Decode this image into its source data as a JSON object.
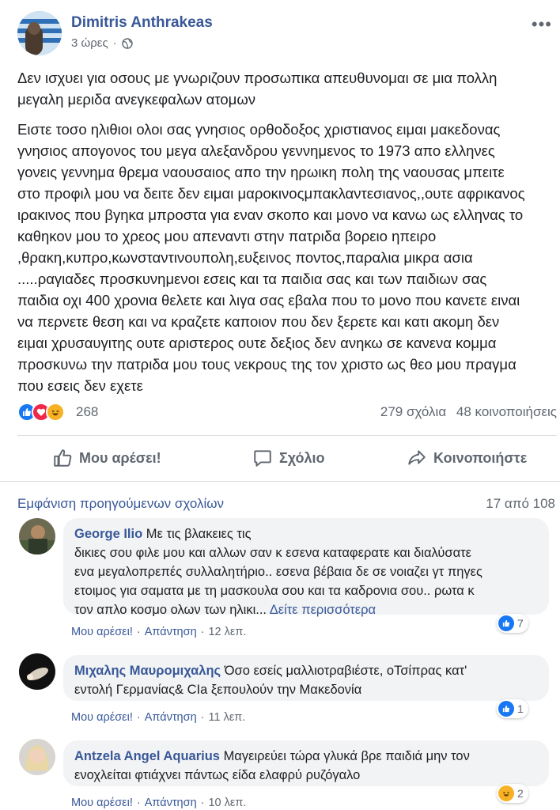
{
  "post": {
    "author": "Dimitris Anthrakeas",
    "time": "3 ώρες",
    "meta_separator": "·",
    "privacy_icon": "globe-icon",
    "more_icon": "ellipsis-icon",
    "paragraph1_lines": [
      "Δεν ισχυει για οσους με γνωριζουν προσωπικα απευθυνομαι σε μια πολλη",
      "μεγαλη μεριδα ανεγκεφαλων ατομων"
    ],
    "paragraph2_lines": [
      "Ειστε τοσο ηλιθιοι ολοι σας γνησιος ορθοδοξος χριστιανος ειμαι μακεδονας",
      "γνησιος απογονος του μεγα αλεξανδρου γεννημενος το 1973 απο ελληνες",
      "γονεις γεννημα θρεμα ναουσαιος απο την ηρωικη πολη της ναουσας μπειτε",
      "στο προφιλ μου να δειτε δεν ειμαι μαροκινοςμπακλαντεσιανος,,ουτε αφρικανος",
      "ιρακινος που βγηκα μπροστα για εναν σκοπο και μονο να κανω ως ελληνας το",
      "καθηκον μου το χρεος μου απεναντι στην πατριδα βορειο ηπειρο",
      ",θρακη,κυπρο,κωνσταντινουπολη,ευξεινος ποντος,παραλια μικρα ασια",
      ".....ραγιαδες προσκυνημενοι εσεις και τα παιδια σας και των παιδιων σας",
      "παιδια οχι 400 χρονια θελετε και λιγα σας εβαλα που το μονο που κανετε ειναι",
      "να περνετε θεση και να κραζετε καποιον που δεν ξερετε και κατι ακομη δεν",
      "ειμαι χρυσαυγιτης ουτε αριστερος ουτε δεξιος δεν ανηκω σε κανενα κομμα",
      "προσκυνω την πατριδα μου τους νεκρους της τον χριστο ως θεο μου πραγμα",
      "που εσεις δεν εχετε"
    ]
  },
  "stats": {
    "reaction_count": "268",
    "comments": "279 σχόλια",
    "shares": "48 κοινοποιήσεις",
    "reaction_icons": [
      "like-icon",
      "love-icon",
      "haha-icon"
    ]
  },
  "actions": {
    "like": "Μου αρέσει!",
    "comment": "Σχόλιο",
    "share": "Κοινοποιήστε"
  },
  "comments_section": {
    "previous_label": "Εμφάνιση προηγούμενων σχολίων",
    "count_label": "17 από 108",
    "like_label": "Μου αρέσει!",
    "reply_label": "Απάντηση",
    "separator": "·",
    "comments": [
      {
        "name": "George Ilio",
        "first_line_rest": "Με τις βλακειες τις",
        "lines": [
          "δικιες σου φιλε μου και αλλων σαν κ εσενα καταφερατε και διαλύσατε",
          "ενα μεγαλοπρεπές συλλαλητήριο.. εσενα βέβαια δε σε νοιαζει γτ πηγες",
          "ετοιμος για σαματα με τη μασκουλα σου και τα καδρονια σου.. ρωτα κ"
        ],
        "last_line": "τον απλο κοσμο ολων των ηλικι...",
        "see_more": "Δείτε περισσότερα",
        "reaction_count": "7",
        "time": "12 λεπ."
      },
      {
        "name": "Μιχαλης Μαυρομιχαλης",
        "first_line_rest": "Όσο εσείς μαλλιοτραβιέστε, οΤσίπρας κατ'",
        "lines": [
          "εντολή Γερμανίας& CIa ξεπουλούν την Μακεδονία"
        ],
        "reaction_count": "1",
        "time": "11 λεπ."
      },
      {
        "name": "Antzela Angel Aquarius",
        "first_line_rest": "Μαγειρεύει τώρα γλυκά βρε παιδιά μην τον",
        "lines": [
          "ενοχλείται φτιάχνει πάντως είδα ελαφρύ ρυζόγαλο"
        ],
        "reaction_count": "2",
        "time": "10 λεπ."
      }
    ]
  },
  "colors": {
    "link_blue": "#385898",
    "text": "#1c1e21",
    "secondary": "#606770",
    "bubble": "#f2f3f5",
    "like_blue": "#1877f2",
    "love_red": "#f02849",
    "haha_yellow": "#f7b125"
  }
}
